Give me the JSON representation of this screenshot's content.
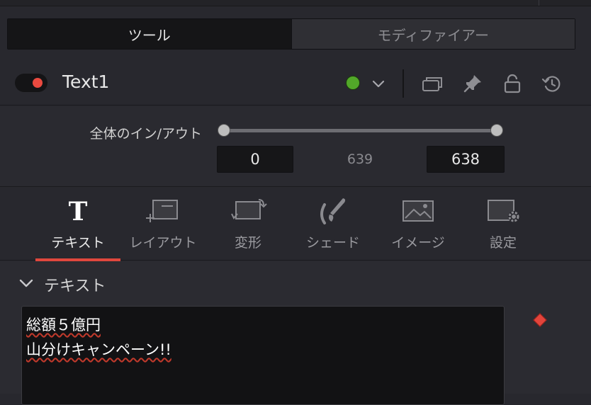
{
  "tabs": [
    {
      "label": "ツール",
      "active": true
    },
    {
      "label": "モディファイアー",
      "active": false
    }
  ],
  "node": {
    "name": "Text1",
    "enabled": true,
    "color": "#52a829"
  },
  "inout": {
    "label": "全体のイン/アウト",
    "in": "0",
    "duration": "639",
    "out": "638"
  },
  "categories": [
    {
      "label": "テキスト",
      "icon": "text-t-icon",
      "active": true
    },
    {
      "label": "レイアウト",
      "icon": "layout-icon",
      "active": false
    },
    {
      "label": "変形",
      "icon": "transform-icon",
      "active": false
    },
    {
      "label": "シェード",
      "icon": "shading-brush-icon",
      "active": false
    },
    {
      "label": "イメージ",
      "icon": "image-icon",
      "active": false
    },
    {
      "label": "設定",
      "icon": "settings-icon",
      "active": false
    }
  ],
  "section": {
    "title": "テキスト",
    "lines": [
      "総額５億円",
      "山分けキャンペーン!!"
    ]
  },
  "colors": {
    "accent": "#e0473d",
    "toggle_on": "#ea4a40",
    "node_color": "#52a829"
  }
}
